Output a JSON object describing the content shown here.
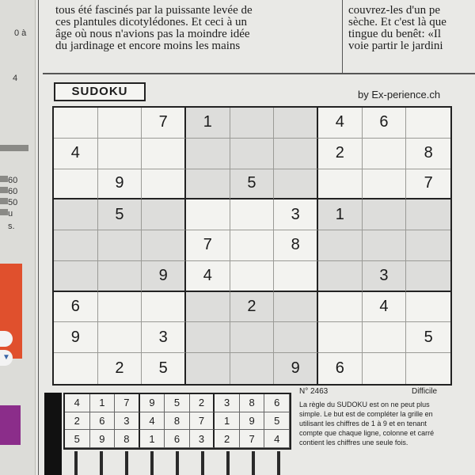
{
  "sidebar": {
    "item_a": "0 à",
    "item_b": "4",
    "levels": [
      "60",
      "60",
      "50",
      "u",
      "s."
    ]
  },
  "article": {
    "left_lines": [
      "tous été fascinés par la puissante levée de",
      "ces plantules dicotylédones. Et ceci à un",
      "âge où nous n'avions pas la moindre idée",
      "du jardinage et encore moins les mains"
    ],
    "right_lines": [
      "couvrez-les d'un pe",
      "sèche. Et c'est là que",
      "tingue du benêt: «Il",
      "voie partir le jardini"
    ]
  },
  "sudoku": {
    "title": "SUDOKU",
    "byline": "by Ex-perience.ch",
    "grid": [
      [
        "",
        "",
        "7",
        "1",
        "",
        "",
        "4",
        "6",
        ""
      ],
      [
        "4",
        "",
        "",
        "",
        "",
        "",
        "2",
        "",
        "8"
      ],
      [
        "",
        "9",
        "",
        "",
        "5",
        "",
        "",
        "",
        "7"
      ],
      [
        "",
        "5",
        "",
        "",
        "",
        "3",
        "1",
        "",
        ""
      ],
      [
        "",
        "",
        "",
        "7",
        "",
        "8",
        "",
        "",
        ""
      ],
      [
        "",
        "",
        "9",
        "4",
        "",
        "",
        "",
        "3",
        ""
      ],
      [
        "6",
        "",
        "",
        "",
        "2",
        "",
        "",
        "4",
        ""
      ],
      [
        "9",
        "",
        "3",
        "",
        "",
        "",
        "",
        "",
        "5"
      ],
      [
        "",
        "2",
        "5",
        "",
        "",
        "9",
        "6",
        "",
        ""
      ]
    ],
    "number": "N° 2463",
    "level": "Difficile",
    "rules": "La règle du SUDOKU est on ne peut plus simple. Le but est de compléter la grille en utilisant les chiffres de 1 à 9 et en tenant compte que chaque ligne, colonne et carré contient les chiffres une seule fois."
  },
  "solution": {
    "rows": [
      [
        "4",
        "1",
        "7",
        "9",
        "5",
        "2",
        "3",
        "8",
        "6"
      ],
      [
        "2",
        "6",
        "3",
        "4",
        "8",
        "7",
        "1",
        "9",
        "5"
      ],
      [
        "5",
        "9",
        "8",
        "1",
        "6",
        "3",
        "2",
        "7",
        "4"
      ]
    ]
  }
}
